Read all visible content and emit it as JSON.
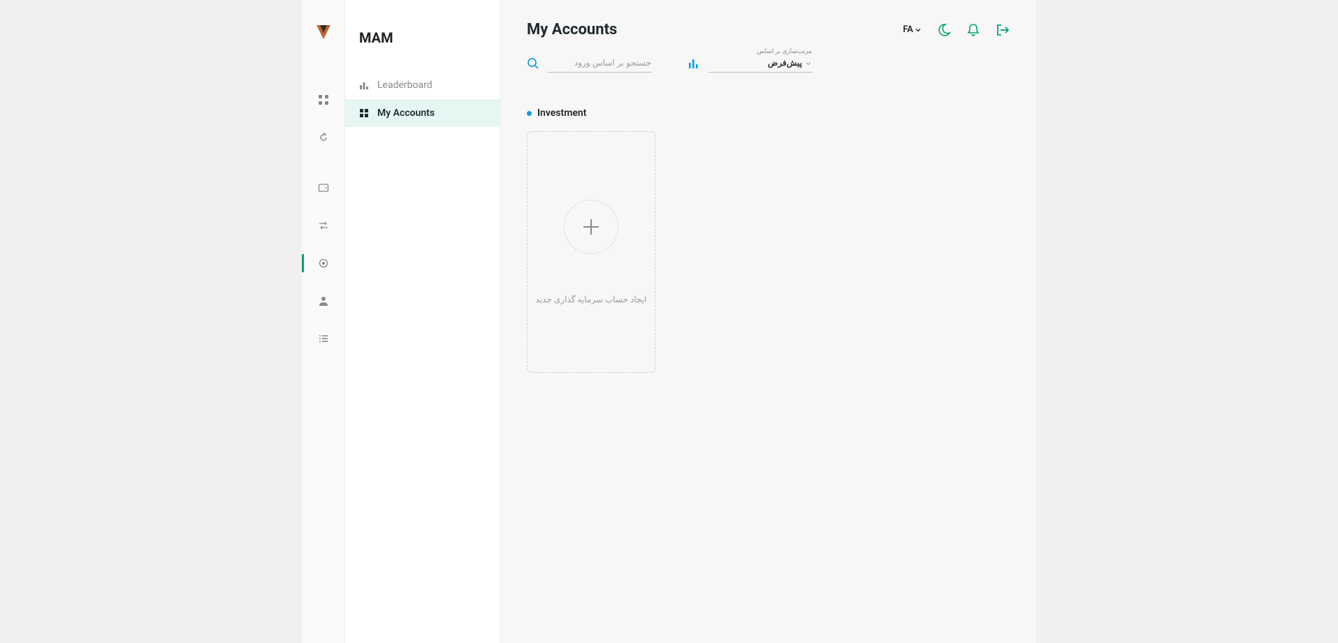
{
  "brand": {
    "section_title": "MAM"
  },
  "sidebar": {
    "items": [
      {
        "label": "Leaderboard"
      },
      {
        "label": "My Accounts"
      }
    ]
  },
  "header": {
    "title": "My Accounts",
    "lang": "FA"
  },
  "filters": {
    "search_placeholder": "جستجو بر اساس ورود",
    "sort_label": "مرتب‌سازی بر اساس",
    "sort_value": "پیش‌فرض"
  },
  "section": {
    "investment_title": "Investment",
    "add_card_label": "ایجاد حساب سرمایه گذاری جدید"
  },
  "colors": {
    "accent_teal": "#00a37a",
    "accent_blue": "#0099e5",
    "active_bg": "#e6f7f3"
  }
}
